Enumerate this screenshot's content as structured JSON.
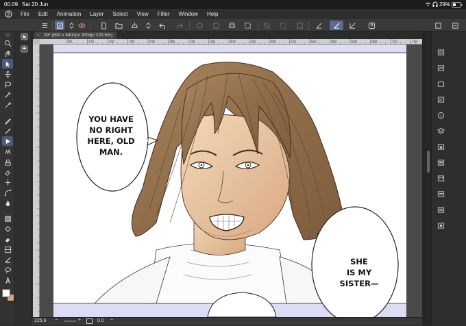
{
  "status": {
    "time": "00.09",
    "date": "Sat 20 Jun",
    "battery": "29%"
  },
  "menu": {
    "items": [
      "File",
      "Edit",
      "Animation",
      "Layer",
      "Select",
      "View",
      "Filter",
      "Window",
      "Help"
    ]
  },
  "document": {
    "tab_title": "29* (800 x 6400px 300dpi 225.6%)"
  },
  "ruler": {
    "h_labels": [
      "80",
      "120",
      "160",
      "200",
      "240",
      "280",
      "320",
      "360",
      "400",
      "440",
      "480",
      "520",
      "560",
      "600",
      "640",
      "680",
      "720",
      "760"
    ]
  },
  "comic": {
    "bubble_left": [
      "YOU HAVE",
      "NO RIGHT",
      "HERE, OLD",
      "MAN."
    ],
    "bubble_right": [
      "SHE",
      "IS MY",
      "SISTER—"
    ]
  },
  "bottom": {
    "zoom": "225.6",
    "rotation": "0.0"
  },
  "colors": {
    "main_color": "#ffffff",
    "sub_color": "#d8a878",
    "band": "#dcdcf4"
  }
}
